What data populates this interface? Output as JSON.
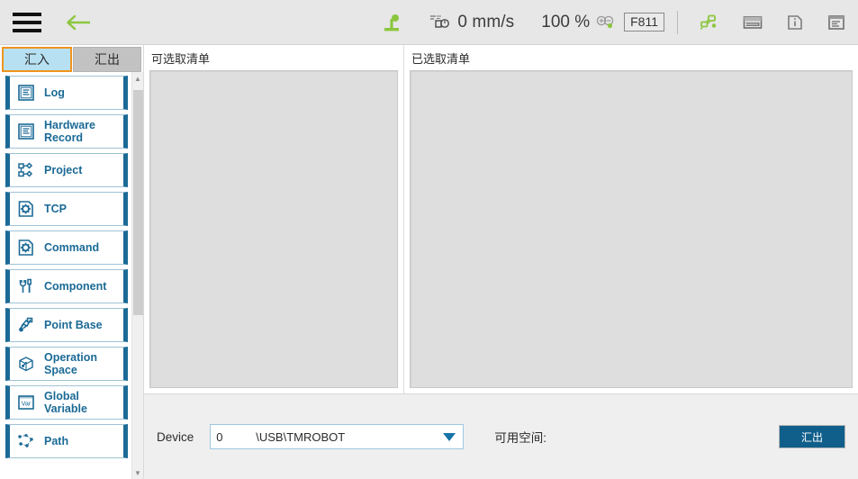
{
  "topbar": {
    "menu_icon": "hamburger-icon",
    "back_icon": "back-arrow-icon",
    "robot_icon": "robot-arm-icon",
    "speed_icon": "speed-gauge-icon",
    "speed_value": "0 mm/s",
    "percent_value": "100 %",
    "zoom_icon": "zoom-in-out-icon",
    "fkey_label": "F811",
    "network_icon": "network-node-icon",
    "keyboard_icon": "keyboard-icon",
    "info_icon": "info-icon",
    "log-panel_icon": "log-panel-icon"
  },
  "sidebar": {
    "tabs": [
      {
        "label": "汇入",
        "active": true
      },
      {
        "label": "汇出",
        "active": false
      }
    ],
    "items": [
      {
        "label": "Log",
        "icon": "document-lines-icon"
      },
      {
        "label": "Hardware Record",
        "icon": "document-lines-icon"
      },
      {
        "label": "Project",
        "icon": "flowchart-nodes-icon"
      },
      {
        "label": "TCP",
        "icon": "gear-document-icon"
      },
      {
        "label": "Command",
        "icon": "gear-document-icon"
      },
      {
        "label": "Component",
        "icon": "wrench-screwdriver-icon"
      },
      {
        "label": "Point Base",
        "icon": "robot-point-icon"
      },
      {
        "label": "Operation\nSpace",
        "icon": "cube-space-icon"
      },
      {
        "label": "Global Variable",
        "icon": "var-box-icon"
      },
      {
        "label": "Path",
        "icon": "path-nodes-icon"
      }
    ],
    "scroll_up_icon": "chevron-up-icon",
    "scroll_down_icon": "chevron-down-icon"
  },
  "main": {
    "available_list_title": "可选取清单",
    "selected_list_title": "已选取清单",
    "available_items": [],
    "selected_items": []
  },
  "footer": {
    "device_label": "Device",
    "device_index": "0",
    "device_path": "\\USB\\TMROBOT",
    "dropdown_icon": "chevron-down-icon",
    "available_space_label": "可用空间:",
    "available_space_value": "",
    "export_button": "汇出"
  },
  "colors": {
    "accent_blue": "#1b6a96",
    "button_blue": "#105f8b",
    "tab_active_bg": "#b7e1f3",
    "tab_active_border": "#f0941e",
    "green_icon": "#8cc63f",
    "topbar_bg": "#e6e7e6",
    "panel_gray": "#dedede"
  }
}
